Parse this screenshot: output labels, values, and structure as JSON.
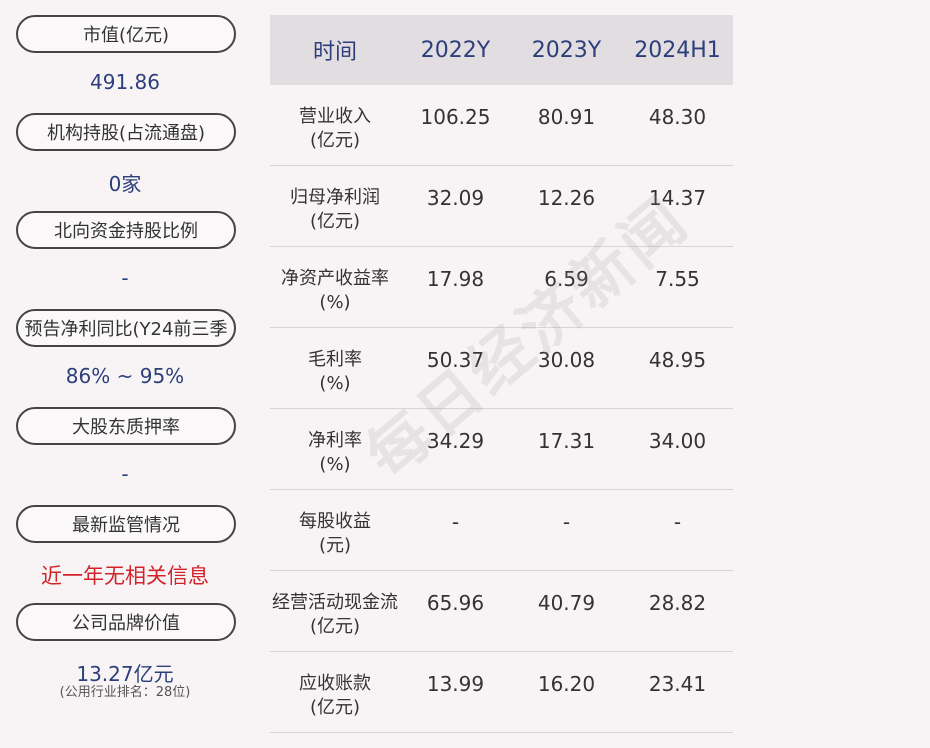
{
  "left_panel": {
    "items": [
      {
        "label": "市值(亿元)",
        "value": "491.86"
      },
      {
        "label": "机构持股(占流通盘)",
        "value": "0家"
      },
      {
        "label": "北向资金持股比例",
        "value": "-"
      },
      {
        "label": "预告净利同比(Y24前三季",
        "value": "86% ~ 95%"
      },
      {
        "label": "大股东质押率",
        "value": "-"
      },
      {
        "label": "最新监管情况",
        "value": "近一年无相关信息"
      },
      {
        "label": "公司品牌价值",
        "value": "13.27亿元",
        "note": "(公用行业排名：28位)"
      }
    ]
  },
  "table": {
    "headers": [
      "时间",
      "2022Y",
      "2023Y",
      "2024H1"
    ],
    "rows": [
      {
        "label_line1": "营业收入",
        "label_line2": "(亿元)",
        "values": [
          "106.25",
          "80.91",
          "48.30"
        ]
      },
      {
        "label_line1": "归母净利润",
        "label_line2": "(亿元)",
        "values": [
          "32.09",
          "12.26",
          "14.37"
        ]
      },
      {
        "label_line1": "净资产收益率",
        "label_line2": "(%)",
        "values": [
          "17.98",
          "6.59",
          "7.55"
        ]
      },
      {
        "label_line1": "毛利率",
        "label_line2": "(%)",
        "values": [
          "50.37",
          "30.08",
          "48.95"
        ]
      },
      {
        "label_line1": "净利率",
        "label_line2": "(%)",
        "values": [
          "34.29",
          "17.31",
          "34.00"
        ]
      },
      {
        "label_line1": "每股收益",
        "label_line2": "(元)",
        "values": [
          "-",
          "-",
          "-"
        ]
      },
      {
        "label_line1": "经营活动现金流",
        "label_line2": "(亿元)",
        "values": [
          "65.96",
          "40.79",
          "28.82"
        ]
      },
      {
        "label_line1": "应收账款",
        "label_line2": "(亿元)",
        "values": [
          "13.99",
          "16.20",
          "23.41"
        ]
      }
    ]
  },
  "watermark": "每日经济新闻",
  "colors": {
    "value_blue": "#2c3f7a",
    "alert_red": "#d2232a",
    "header_bg": "#e2dde0",
    "page_bg": "#f8f4f6"
  }
}
